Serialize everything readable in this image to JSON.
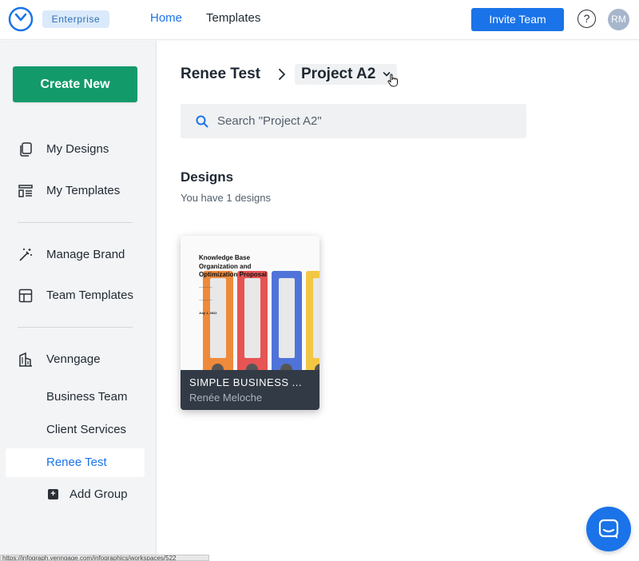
{
  "header": {
    "badge": "Enterprise",
    "nav": [
      {
        "label": "Home",
        "active": true
      },
      {
        "label": "Templates",
        "active": false
      }
    ],
    "invite_label": "Invite Team",
    "help_label": "?",
    "avatar_initials": "RM"
  },
  "sidebar": {
    "create_label": "Create New",
    "items": [
      {
        "label": "My Designs",
        "icon": "copy-icon"
      },
      {
        "label": "My Templates",
        "icon": "template-list-icon"
      },
      {
        "label": "Manage Brand",
        "icon": "magic-wand-icon"
      },
      {
        "label": "Team Templates",
        "icon": "grid-icon"
      },
      {
        "label": "Venngage",
        "icon": "building-icon"
      }
    ],
    "groups": [
      "Business Team",
      "Client Services",
      "Renee Test"
    ],
    "active_group": "Renee Test",
    "add_group_label": "Add Group"
  },
  "breadcrumb": {
    "root": "Renee Test",
    "current": "Project A2"
  },
  "search": {
    "placeholder": "Search \"Project A2\""
  },
  "designs": {
    "title": "Designs",
    "subtitle": "You have 1 designs",
    "items": [
      {
        "name": "SIMPLE BUSINESS ...",
        "author": "Renée Meloche",
        "thumbnail_title": "Knowledge Base Organization and Optimization Proposal",
        "thumbnail_date": "July 1, 2022"
      }
    ]
  },
  "status_bar_url": "https://infograph.venngage.com/infographics/workspaces/522",
  "colors": {
    "accent": "#1a73e8",
    "create": "#139a6b",
    "binders": [
      "#ee8a3c",
      "#e65454",
      "#4f73d9",
      "#f2c744"
    ]
  }
}
